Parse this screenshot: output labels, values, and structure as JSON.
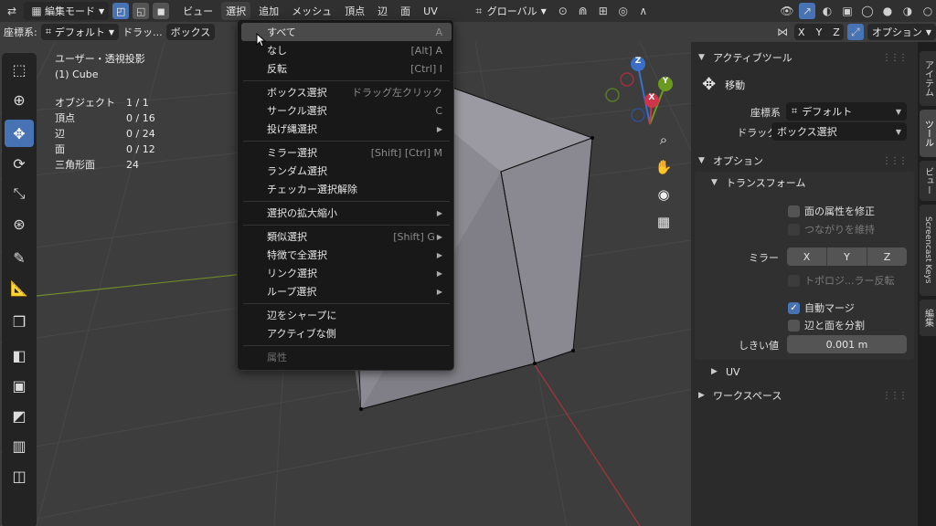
{
  "header": {
    "mode": "編集モード",
    "menus": [
      "ビュー",
      "選択",
      "追加",
      "メッシュ",
      "頂点",
      "辺",
      "面",
      "UV"
    ],
    "orientation": "グローバル",
    "axes": [
      "X",
      "Y",
      "Z"
    ],
    "options": "オプション"
  },
  "subbar": {
    "coord_label": "座標系:",
    "coord_value": "デフォルト",
    "drag_label": "ドラッ...",
    "drag_value": "ボックス"
  },
  "overlay": {
    "view_name": "ユーザー・透視投影",
    "object_name": "(1) Cube",
    "stats": [
      {
        "label": "オブジェクト",
        "value": "1 / 1"
      },
      {
        "label": "頂点",
        "value": "0 / 16"
      },
      {
        "label": "辺",
        "value": "0 / 24"
      },
      {
        "label": "面",
        "value": "0 / 12"
      },
      {
        "label": "三角形面",
        "value": "24"
      }
    ]
  },
  "select_menu": {
    "items": [
      {
        "label": "すべて",
        "shortcut": "A"
      },
      {
        "label": "なし",
        "shortcut": "[Alt] A"
      },
      {
        "label": "反転",
        "shortcut": "[Ctrl] I"
      },
      {
        "label": "ボックス選択",
        "shortcut": "ドラッグ左クリック"
      },
      {
        "label": "サークル選択",
        "shortcut": "C"
      },
      {
        "label": "投げ縄選択",
        "shortcut": ""
      },
      {
        "label": "ミラー選択",
        "shortcut": "[Shift] [Ctrl] M"
      },
      {
        "label": "ランダム選択",
        "shortcut": ""
      },
      {
        "label": "チェッカー選択解除",
        "shortcut": ""
      },
      {
        "label": "選択の拡大縮小",
        "shortcut": ""
      },
      {
        "label": "類似選択",
        "shortcut": "[Shift] G"
      },
      {
        "label": "特徴で全選択",
        "shortcut": ""
      },
      {
        "label": "リンク選択",
        "shortcut": ""
      },
      {
        "label": "ループ選択",
        "shortcut": ""
      },
      {
        "label": "辺をシャープに",
        "shortcut": ""
      },
      {
        "label": "アクティブな側",
        "shortcut": ""
      },
      {
        "label": "属性",
        "shortcut": ""
      }
    ]
  },
  "gizmo": {
    "x": "X",
    "y": "Y",
    "z": "Z"
  },
  "sidebar": {
    "active_tool_title": "アクティブツール",
    "tool_name": "移動",
    "coord_label": "座標系",
    "coord_value": "デフォルト",
    "drag_label": "ドラッグ:",
    "drag_value": "ボックス選択",
    "options_title": "オプション",
    "transform_title": "トランスフォーム",
    "correct_face_attr": "面の属性を修正",
    "keep_connected": "つながりを維持",
    "mirror_label": "ミラー",
    "mirror_axes": [
      "X",
      "Y",
      "Z"
    ],
    "topology_mirror": "トポロジ...ラー反転",
    "auto_merge": "自動マージ",
    "split_edges": "辺と面を分割",
    "threshold_label": "しきい値",
    "threshold_value": "0.001 m",
    "uv_title": "UV",
    "workspace_title": "ワークスペース"
  },
  "tabs": [
    "アイテム",
    "ツール",
    "ビュー",
    "Screencast Keys",
    "編集"
  ]
}
